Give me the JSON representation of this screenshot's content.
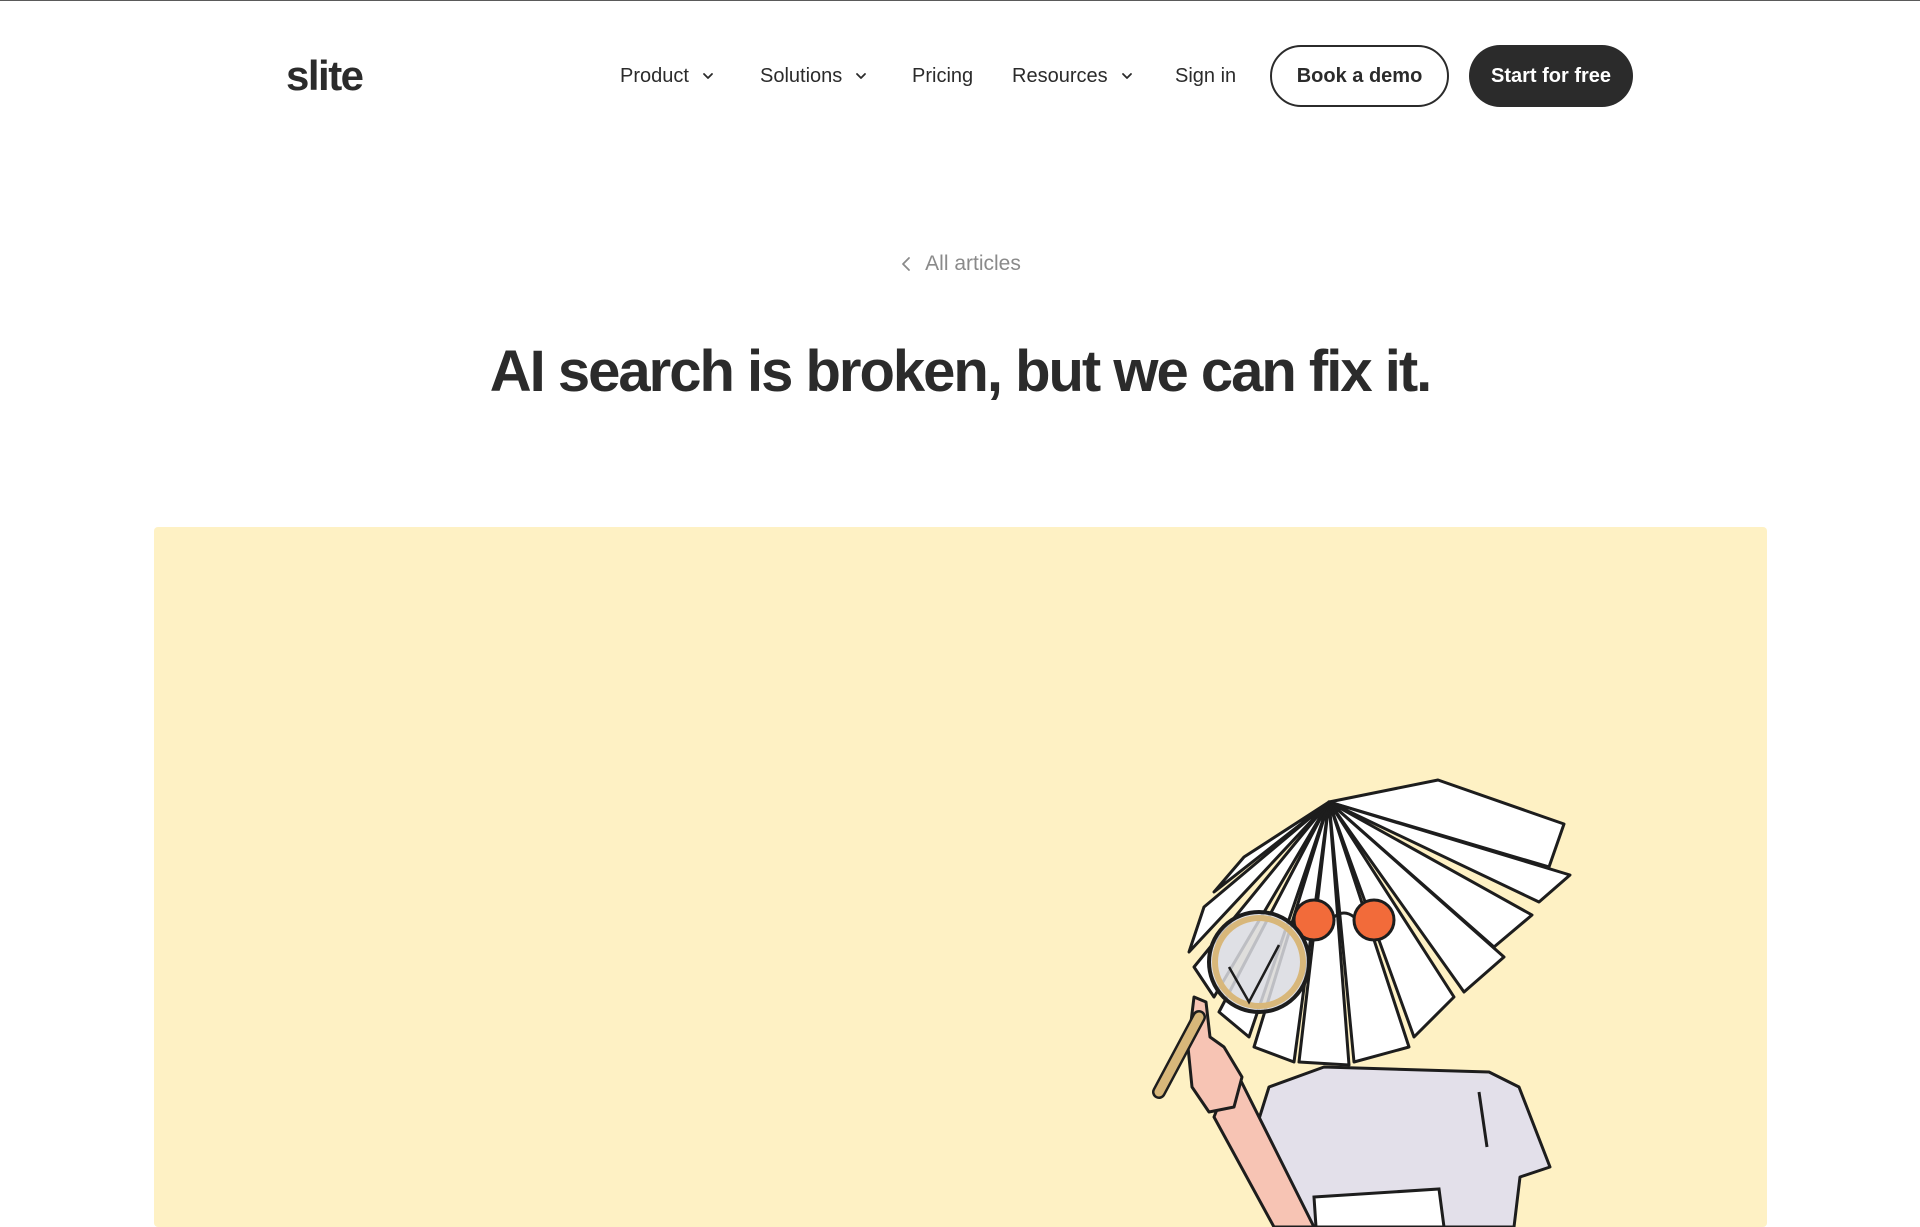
{
  "header": {
    "logo": "slite",
    "nav": {
      "product": "Product",
      "solutions": "Solutions",
      "pricing": "Pricing",
      "resources": "Resources",
      "sign_in": "Sign in"
    },
    "book_demo": "Book a demo",
    "start_free": "Start for free"
  },
  "article": {
    "back_label": "All articles",
    "title": "AI search is broken, but we can fix it."
  },
  "hero": {
    "background_color": "#fef1c4",
    "illustration": "person-with-book-head-holding-magnifying-glass"
  },
  "colors": {
    "text": "#2b2b2b",
    "muted": "#8a8a8a",
    "accent_orange": "#f26b3a"
  }
}
